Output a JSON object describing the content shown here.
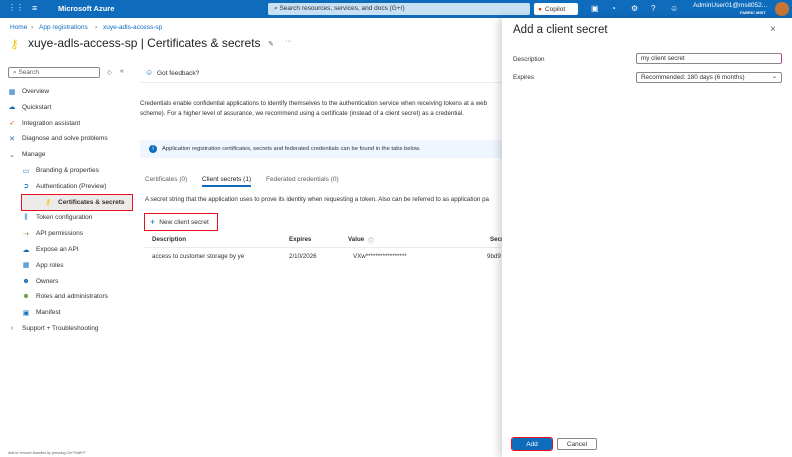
{
  "topbar": {
    "brand": "Microsoft Azure",
    "search_placeholder": "Search resources, services, and docs (G+/)",
    "copilot": "Copilot",
    "user": "AdminUser01@msit052...",
    "tenant": "FABRIC MSIT"
  },
  "breadcrumb": [
    "Home",
    "App registrations",
    "xuye-adls-access-sp"
  ],
  "page_title": "xuye-adls-access-sp | Certificates & secrets",
  "sidebar": {
    "search_placeholder": "Search",
    "items": [
      {
        "label": "Overview",
        "icon": "overview-icon"
      },
      {
        "label": "Quickstart",
        "icon": "quickstart-icon"
      },
      {
        "label": "Integration assistant",
        "icon": "rocket-icon"
      },
      {
        "label": "Diagnose and solve problems",
        "icon": "wrench-icon"
      },
      {
        "label": "Manage",
        "icon": "chevron-down-icon"
      },
      {
        "label": "Branding & properties",
        "icon": "branding-icon"
      },
      {
        "label": "Authentication (Preview)",
        "icon": "authentication-icon"
      },
      {
        "label": "Certificates & secrets",
        "icon": "key-icon",
        "selected": true
      },
      {
        "label": "Token configuration",
        "icon": "token-icon"
      },
      {
        "label": "API permissions",
        "icon": "api-icon"
      },
      {
        "label": "Expose an API",
        "icon": "cloud-icon"
      },
      {
        "label": "App roles",
        "icon": "app-roles-icon"
      },
      {
        "label": "Owners",
        "icon": "owners-icon"
      },
      {
        "label": "Roles and administrators",
        "icon": "roles-icon"
      },
      {
        "label": "Manifest",
        "icon": "manifest-icon"
      },
      {
        "label": "Support + Troubleshooting",
        "icon": "chevron-right-icon"
      }
    ],
    "footer": "Add or remove favorites by pressing Ctrl+Shift+F"
  },
  "main": {
    "feedback": "Got feedback?",
    "intro1": "Credentials enable confidential applications to identify themselves to the authentication service when receiving tokens at a web",
    "intro2": "scheme). For a higher level of assurance, we recommend using a certificate (instead of a client secret) as a credential.",
    "banner": "Application registration certificates, secrets and federated credentials can be found in the tabs below.",
    "tabs": [
      "Certificates (0)",
      "Client secrets (1)",
      "Federated credentials (0)"
    ],
    "tab_desc": "A secret string that the application uses to prove its identity when requesting a token. Also can be referred to as application pa",
    "new_secret": "New client secret",
    "columns": [
      "Description",
      "Expires",
      "Value",
      "Secr"
    ],
    "rows": [
      [
        "access to customer storage by ye",
        "2/10/2026",
        "VXw*****************",
        "9bd9"
      ]
    ]
  },
  "panel": {
    "title": "Add a client secret",
    "description_label": "Description",
    "description_value": "my client secret",
    "expires_label": "Expires",
    "expires_value": "Recommended: 180 days (6 months)",
    "add": "Add",
    "cancel": "Cancel"
  }
}
